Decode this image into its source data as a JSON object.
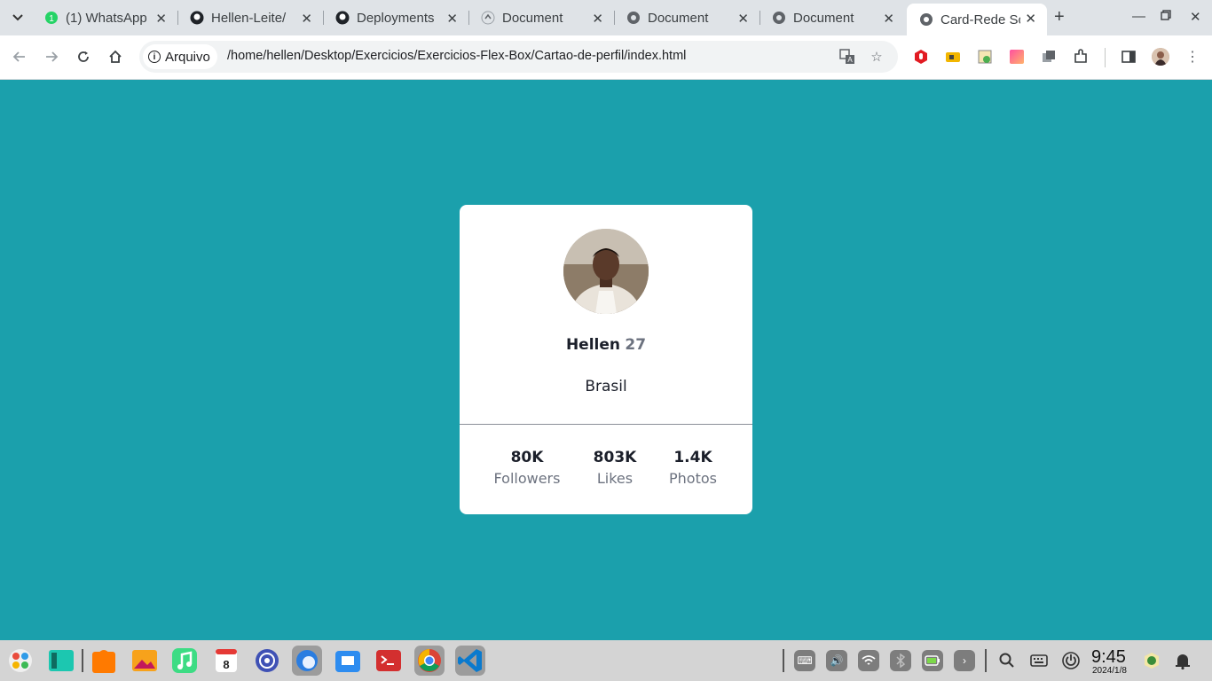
{
  "tabs": [
    {
      "title": "(1) WhatsApp",
      "icon": "whatsapp-icon"
    },
    {
      "title": "Hellen-Leite/",
      "icon": "github-icon"
    },
    {
      "title": "Deployments",
      "icon": "github-icon"
    },
    {
      "title": "Document",
      "icon": "document-icon"
    },
    {
      "title": "Document",
      "icon": "globe-icon"
    },
    {
      "title": "Document",
      "icon": "globe-icon"
    },
    {
      "title": "Card-Rede So",
      "icon": "globe-icon",
      "active": true
    }
  ],
  "toolbar": {
    "security_chip": "Arquivo",
    "url": "/home/hellen/Desktop/Exercicios/Exercicios-Flex-Box/Cartao-de-perfil/index.html"
  },
  "page": {
    "background": "#1ba0ac",
    "card": {
      "name": "Hellen",
      "age": "27",
      "country": "Brasil",
      "stats": [
        {
          "value": "80K",
          "label": "Followers"
        },
        {
          "value": "803K",
          "label": "Likes"
        },
        {
          "value": "1.4K",
          "label": "Photos"
        }
      ]
    }
  },
  "taskbar": {
    "time": "9:45",
    "date": "2024/1/8",
    "calendar_day": "8"
  }
}
